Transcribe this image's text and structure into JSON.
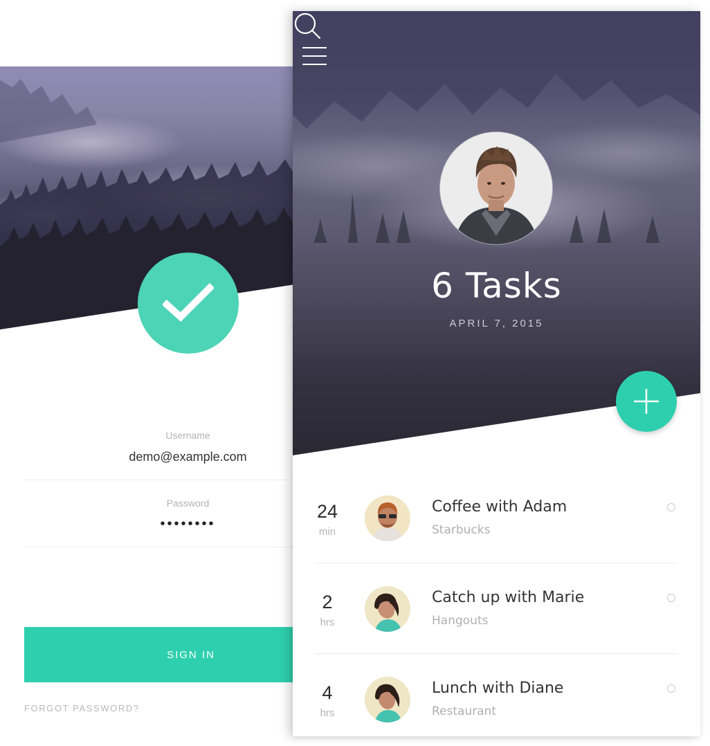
{
  "login": {
    "username_label": "Username",
    "username_value": "demo@example.com",
    "password_label": "Password",
    "password_value": "••••••••",
    "signin_label": "SIGN IN",
    "forgot_label": "FORGOT PASSWORD?",
    "icons": {
      "badge": "checkmark-icon"
    }
  },
  "tasks_screen": {
    "icons": {
      "menu": "hamburger-menu-icon",
      "search": "search-icon",
      "add": "plus-icon"
    },
    "title": "6 Tasks",
    "date": "APRIL 7, 2015",
    "items": [
      {
        "number": "24",
        "unit": "min",
        "title": "Coffee with Adam",
        "subtitle": "Starbucks"
      },
      {
        "number": "2",
        "unit": "hrs",
        "title": "Catch up with Marie",
        "subtitle": "Hangouts"
      },
      {
        "number": "4",
        "unit": "hrs",
        "title": "Lunch with Diane",
        "subtitle": "Restaurant"
      }
    ]
  },
  "colors": {
    "accent": "#2ecfae",
    "badge": "#4dd3b6",
    "hero_dark": "#2a2838",
    "hero_light": "#8f8bb3"
  }
}
